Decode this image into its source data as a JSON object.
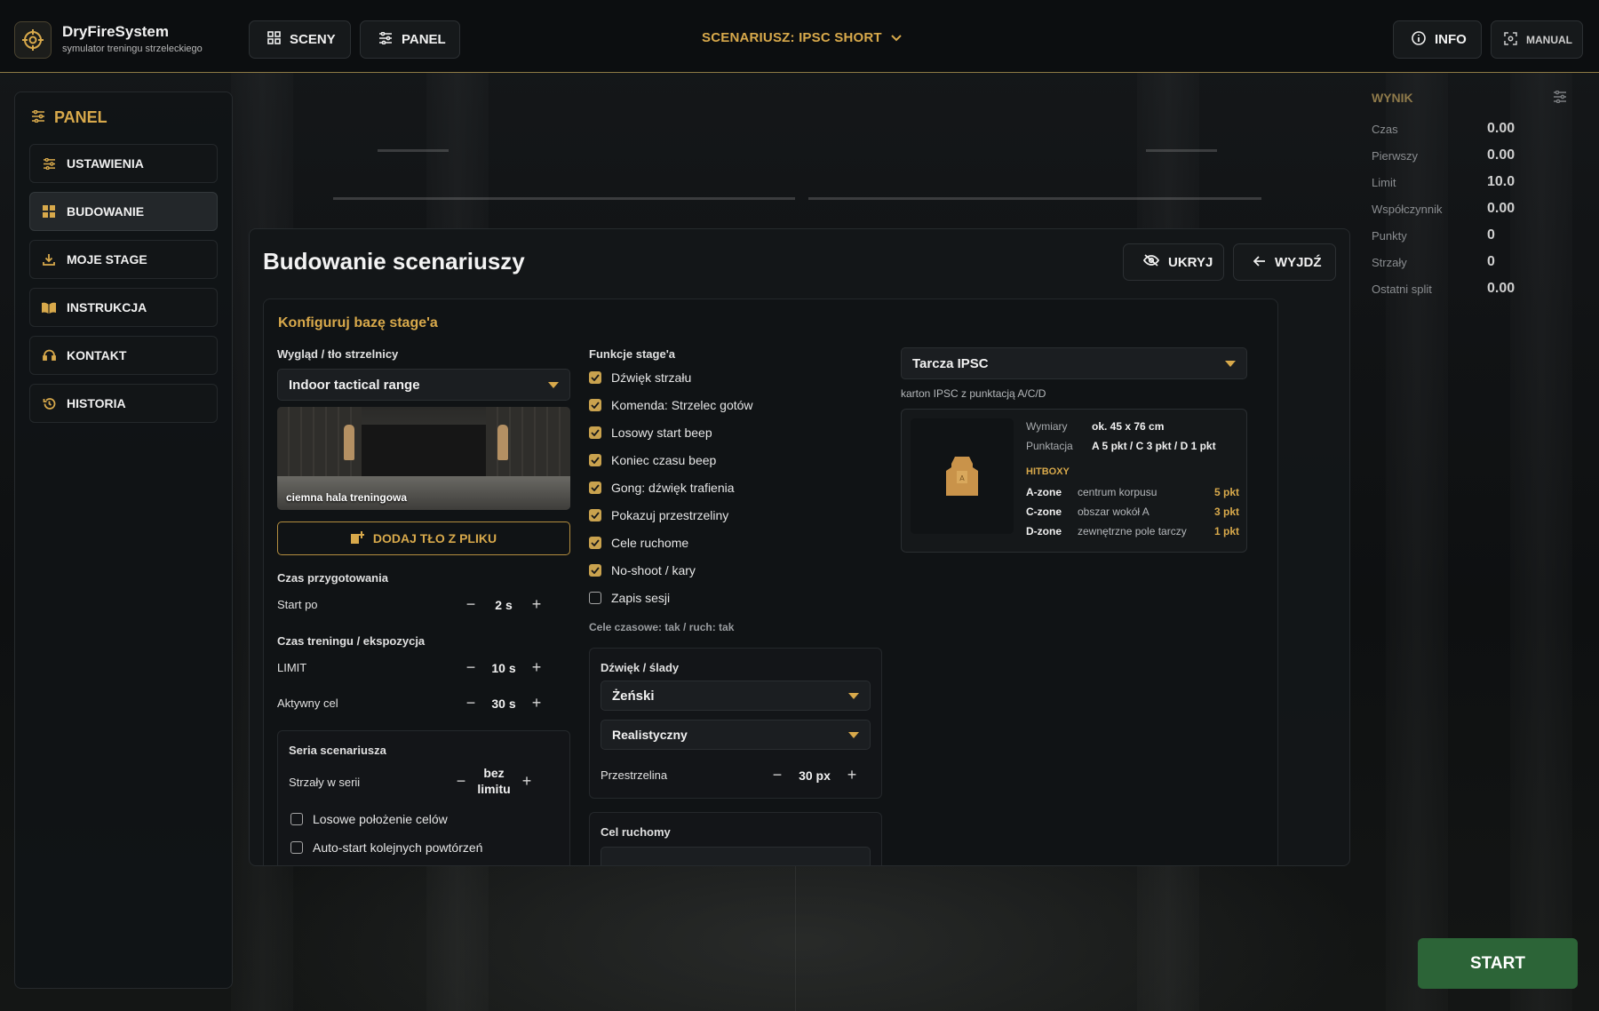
{
  "app": {
    "name": "DryFireSystem",
    "subtitle": "symulator treningu strzeleckiego"
  },
  "topbar": {
    "sceny_label": "SCENY",
    "panel_label": "PANEL",
    "scenario_label": "SCENARIUSZ: IPSC SHORT",
    "info_label": "INFO",
    "manual_label": "MANUAL"
  },
  "sidebar": {
    "title": "PANEL",
    "items": [
      {
        "label": "USTAWIENIA",
        "icon": "sliders-icon"
      },
      {
        "label": "BUDOWANIE",
        "icon": "grid-icon"
      },
      {
        "label": "MOJE STAGE",
        "icon": "download-icon"
      },
      {
        "label": "INSTRUKCJA",
        "icon": "book-icon"
      },
      {
        "label": "KONTAKT",
        "icon": "headset-icon"
      },
      {
        "label": "HISTORIA",
        "icon": "history-icon"
      }
    ]
  },
  "score": {
    "title": "WYNIK",
    "rows": [
      {
        "label": "Czas",
        "value": "0.00"
      },
      {
        "label": "Pierwszy",
        "value": "0.00"
      },
      {
        "label": "Limit",
        "value": "10.0"
      },
      {
        "label": "Współczynnik",
        "value": "0.00"
      },
      {
        "label": "Punkty",
        "value": "0"
      },
      {
        "label": "Strzały",
        "value": "0"
      },
      {
        "label": "Ostatni split",
        "value": "0.00"
      }
    ]
  },
  "builder": {
    "title": "Budowanie scenariuszy",
    "hide_label": "UKRYJ",
    "exit_label": "WYJDŹ",
    "section_title": "Konfiguruj bazę stage'a",
    "appearance": {
      "label": "Wygląd / tło strzelnicy",
      "selected": "Indoor tactical range",
      "preview_caption": "ciemna hala treningowa",
      "add_bg_label": "DODAJ TŁO Z PLIKU"
    },
    "prep": {
      "label": "Czas przygotowania",
      "start_label": "Start po",
      "start_value": "2 s"
    },
    "training": {
      "label": "Czas treningu / ekspozycja",
      "limit_label": "LIMIT",
      "limit_value": "10 s",
      "active_label": "Aktywny cel",
      "active_value": "30 s"
    },
    "series": {
      "label": "Seria scenariusza",
      "shots_label": "Strzały w serii",
      "shots_value_line1": "bez",
      "shots_value_line2": "limitu",
      "random_label": "Losowe położenie celów",
      "autostart_label": "Auto-start kolejnych powtórzeń"
    },
    "functions": {
      "label": "Funkcje stage'a",
      "items": [
        {
          "label": "Dźwięk strzału",
          "checked": true
        },
        {
          "label": "Komenda: Strzelec gotów",
          "checked": true
        },
        {
          "label": "Losowy start beep",
          "checked": true
        },
        {
          "label": "Koniec czasu beep",
          "checked": true
        },
        {
          "label": "Gong: dźwięk trafienia",
          "checked": true
        },
        {
          "label": "Pokazuj przestrzeliny",
          "checked": true
        },
        {
          "label": "Cele ruchome",
          "checked": true
        },
        {
          "label": "No-shoot / kary",
          "checked": true
        },
        {
          "label": "Zapis sesji",
          "checked": false
        }
      ],
      "note": "Cele czasowe: tak / ruch: tak"
    },
    "sound": {
      "label": "Dźwięk / ślady",
      "voice": "Żeński",
      "mode": "Realistyczny",
      "hole_label": "Przestrzelina",
      "hole_value": "30 px"
    },
    "moving": {
      "label": "Cel ruchomy"
    },
    "target": {
      "selected": "Tarcza IPSC",
      "description": "karton IPSC z punktacją A/C/D",
      "dims_label": "Wymiary",
      "dims_value": "ok. 45 x 76 cm",
      "scoring_label": "Punktacja",
      "scoring_value": "A 5 pkt / C 3 pkt / D 1 pkt",
      "hitbox_title": "HITBOXY",
      "thumb_letter": "A",
      "hitboxes": [
        {
          "zone": "A-zone",
          "desc": "centrum korpusu",
          "pts": "5 pkt"
        },
        {
          "zone": "C-zone",
          "desc": "obszar wokół A",
          "pts": "3 pkt"
        },
        {
          "zone": "D-zone",
          "desc": "zewnętrzne pole tarczy",
          "pts": "1 pkt"
        }
      ]
    }
  },
  "start_label": "START",
  "colors": {
    "accent": "#d8a94b",
    "start_green": "#2f6b3a",
    "panel_bg": "#13161a"
  }
}
